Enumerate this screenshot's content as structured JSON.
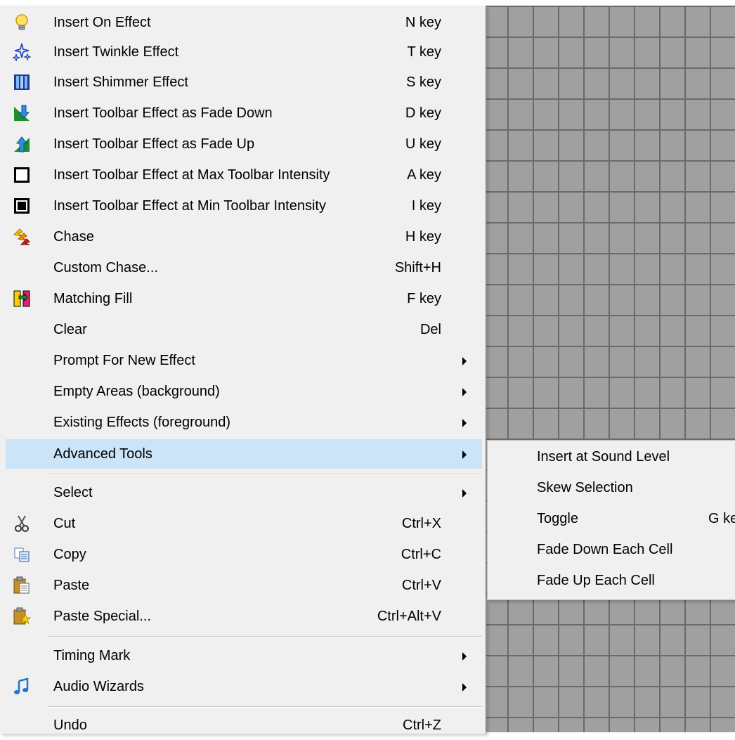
{
  "menu": {
    "items": [
      {
        "label": "Insert On Effect",
        "shortcut": "N key",
        "icon": "lightbulb-icon"
      },
      {
        "label": "Insert Twinkle Effect",
        "shortcut": "T key",
        "icon": "twinkle-stars-icon"
      },
      {
        "label": "Insert Shimmer Effect",
        "shortcut": "S key",
        "icon": "shimmer-icon"
      },
      {
        "label": "Insert Toolbar Effect as Fade Down",
        "shortcut": "D key",
        "icon": "fade-down-icon"
      },
      {
        "label": "Insert Toolbar Effect as Fade Up",
        "shortcut": "U key",
        "icon": "fade-up-icon"
      },
      {
        "label": "Insert Toolbar Effect at Max Toolbar Intensity",
        "shortcut": "A key",
        "icon": "max-intensity-icon"
      },
      {
        "label": "Insert Toolbar Effect at Min Toolbar Intensity",
        "shortcut": "I key",
        "icon": "min-intensity-icon"
      },
      {
        "label": "Chase",
        "shortcut": "H key",
        "icon": "chase-icon"
      },
      {
        "label": "Custom Chase...",
        "shortcut": "Shift+H",
        "icon": ""
      },
      {
        "label": "Matching Fill",
        "shortcut": "F key",
        "icon": "matching-fill-icon"
      },
      {
        "label": "Clear",
        "shortcut": "Del",
        "icon": ""
      },
      {
        "label": "Prompt For New Effect",
        "shortcut": "",
        "icon": ""
      },
      {
        "label": "Empty Areas (background)",
        "shortcut": "",
        "icon": ""
      },
      {
        "label": "Existing Effects (foreground)",
        "shortcut": "",
        "icon": ""
      },
      {
        "label": "Advanced Tools",
        "shortcut": "",
        "icon": ""
      },
      {
        "label": "Select",
        "shortcut": "",
        "icon": ""
      },
      {
        "label": "Cut",
        "shortcut": "Ctrl+X",
        "icon": "scissors-icon"
      },
      {
        "label": "Copy",
        "shortcut": "Ctrl+C",
        "icon": "copy-icon"
      },
      {
        "label": "Paste",
        "shortcut": "Ctrl+V",
        "icon": "paste-icon"
      },
      {
        "label": "Paste Special...",
        "shortcut": "Ctrl+Alt+V",
        "icon": "paste-special-icon"
      },
      {
        "label": "Timing Mark",
        "shortcut": "",
        "icon": ""
      },
      {
        "label": "Audio Wizards",
        "shortcut": "",
        "icon": "music-note-icon"
      },
      {
        "label": "Undo",
        "shortcut": "Ctrl+Z",
        "icon": ""
      }
    ]
  },
  "submenu": {
    "items": [
      {
        "label": "Insert at Sound Level",
        "shortcut": ""
      },
      {
        "label": "Skew Selection",
        "shortcut": ""
      },
      {
        "label": "Toggle",
        "shortcut": "G key"
      },
      {
        "label": "Fade Down Each Cell",
        "shortcut": ""
      },
      {
        "label": "Fade Up Each Cell",
        "shortcut": ""
      }
    ]
  },
  "colors": {
    "highlight": "#cce4f7",
    "menu_bg": "#f0f0f0",
    "grid_bg": "#a0a0a0",
    "grid_line": "#6a6a6a"
  }
}
